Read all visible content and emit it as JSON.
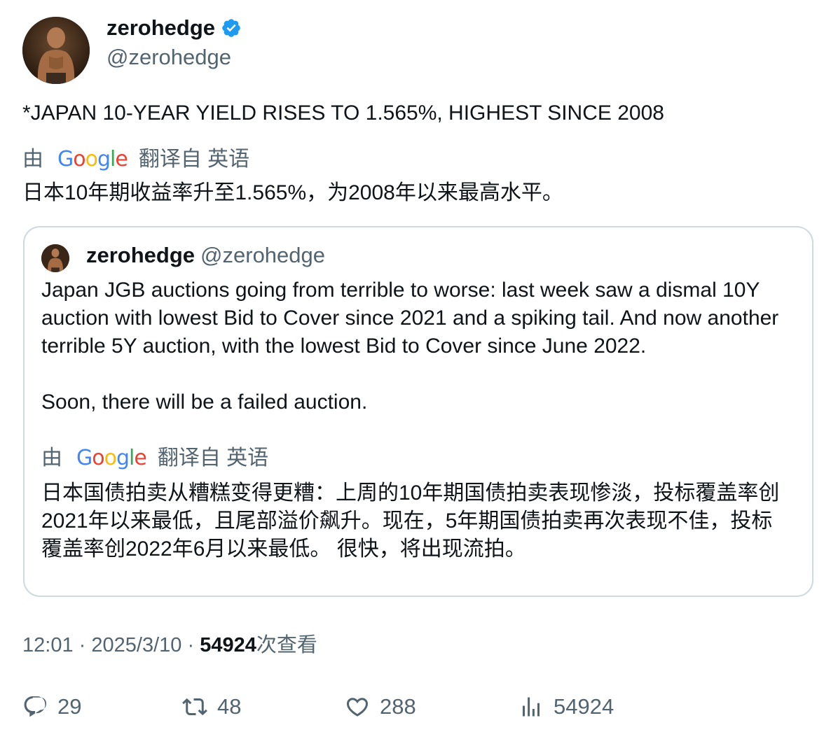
{
  "author": {
    "display_name": "zerohedge",
    "handle": "@zerohedge",
    "verified_icon": "verified-badge-icon",
    "avatar_icon": "avatar-image"
  },
  "tweet": {
    "text": "*JAPAN 10-YEAR YIELD RISES TO 1.565%, HIGHEST SINCE 2008",
    "translation": {
      "by_prefix": "由",
      "provider": "Google",
      "from_label": "翻译自 英语",
      "text": "日本10年期收益率升至1.565%，为2008年以来最高水平。"
    }
  },
  "quoted_tweet": {
    "display_name": "zerohedge",
    "handle": "@zerohedge",
    "paragraphs": [
      "Japan JGB auctions going from terrible to worse: last week saw a dismal 10Y auction with lowest Bid to Cover since 2021 and a spiking tail. And now another terrible 5Y auction, with the lowest Bid to Cover since June 2022.",
      "Soon, there will be a failed auction."
    ],
    "translation": {
      "by_prefix": "由",
      "provider": "Google",
      "from_label": "翻译自 英语",
      "text": "日本国债拍卖从糟糕变得更糟：上周的10年期国债拍卖表现惨淡，投标覆盖率创2021年以来最低，且尾部溢价飙升。现在，5年期国债拍卖再次表现不佳，投标覆盖率创2022年6月以来最低。 很快，将出现流拍。"
    }
  },
  "meta": {
    "time": "12:01",
    "separator": "·",
    "date": "2025/3/10",
    "views_count": "54924",
    "views_label": "次查看"
  },
  "actions": {
    "reply_count": "29",
    "retweet_count": "48",
    "like_count": "288",
    "views_count": "54924"
  },
  "colors": {
    "text": "#0f1419",
    "secondary": "#536471",
    "border": "#cfd9de",
    "verified": "#1d9bf0"
  }
}
